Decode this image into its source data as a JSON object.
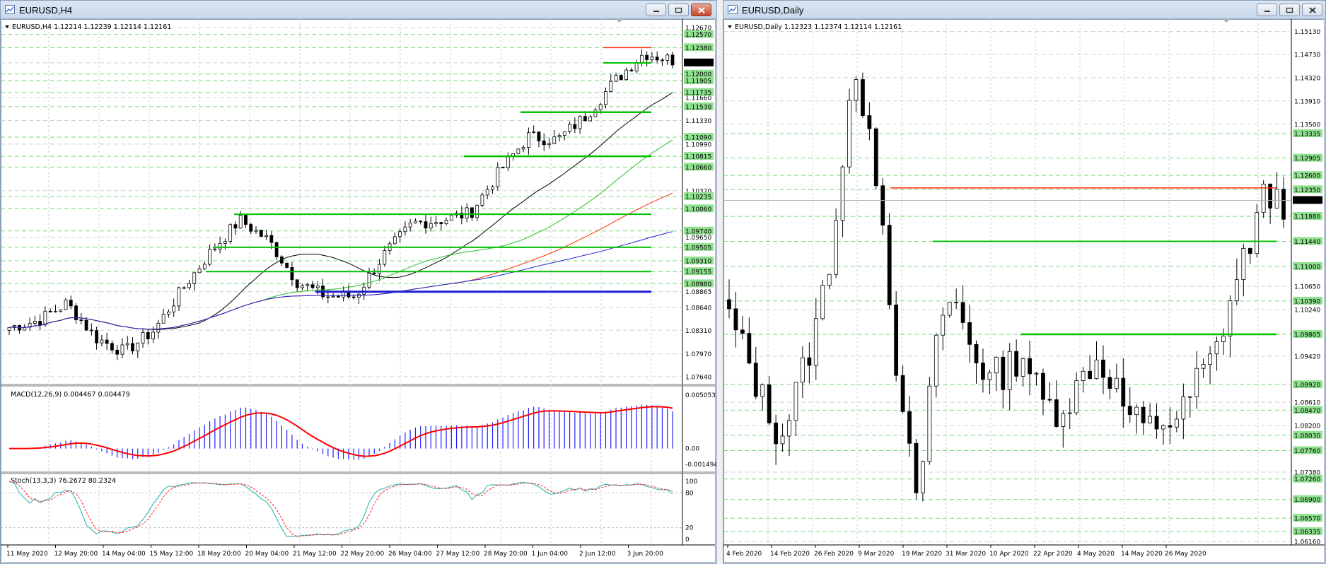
{
  "windows": {
    "left": {
      "title": "EURUSD,H4"
    },
    "right": {
      "title": "EURUSD,Daily"
    }
  },
  "h4": {
    "header": "EURUSD,H4  1.12214 1.12239 1.12114 1.12161",
    "price_labels": [
      "1.12670",
      "1.12570",
      "1.12380",
      "1.12161",
      "1.12000",
      "1.11905",
      "1.11660",
      "1.11735",
      "1.11530",
      "1.11330",
      "1.11090",
      "1.10990",
      "1.10815",
      "1.10660",
      "1.10320",
      "1.10235",
      "1.10060",
      "1.09740",
      "1.09650",
      "1.09505",
      "1.09310",
      "1.09155",
      "1.08980",
      "1.08865",
      "1.08640",
      "1.08310",
      "1.07970",
      "1.07640"
    ],
    "macd_header": "MACD(12,26,9) 0.004467 0.004479",
    "macd_labels": [
      "0.005053",
      "0.00",
      "-0.001494"
    ],
    "stoch_header": "Stoch(13,3,3) 76.2672 80.2324",
    "stoch_labels": [
      "100",
      "80",
      "20",
      "0"
    ],
    "time_labels": [
      "11 May 2020",
      "12 May 20:00",
      "14 May 04:00",
      "15 May 12:00",
      "18 May 20:00",
      "20 May 04:00",
      "21 May 12:00",
      "22 May 20:00",
      "26 May 04:00",
      "27 May 12:00",
      "28 May 20:00",
      "1 Jun 04:00",
      "2 Jun 12:00",
      "3 Jun 20:00"
    ]
  },
  "daily": {
    "header": "EURUSD,Daily  1.12323 1.12374 1.12114 1.12161",
    "price_labels": [
      "1.15130",
      "1.14730",
      "1.14320",
      "1.13910",
      "1.13500",
      "1.13335",
      "1.12905",
      "1.12600",
      "1.12350",
      "1.12161",
      "1.11880",
      "1.11440",
      "1.11000",
      "1.10650",
      "1.10390",
      "1.10240",
      "1.09805",
      "1.09420",
      "1.08920",
      "1.08610",
      "1.08470",
      "1.08200",
      "1.08030",
      "1.07760",
      "1.07380",
      "1.07260",
      "1.06900",
      "1.06570",
      "1.06335",
      "1.06160"
    ],
    "time_labels": [
      "4 Feb 2020",
      "14 Feb 2020",
      "26 Feb 2020",
      "9 Mar 2020",
      "19 Mar 2020",
      "31 Mar 2020",
      "10 Apr 2020",
      "22 Apr 2020",
      "4 May 2020",
      "14 May 2020",
      "26 May 2020"
    ]
  },
  "colors": {
    "bull_candle": "#ffffff",
    "bear_candle": "#000000",
    "support_line": "#00c000",
    "resistance_line": "#ff2a00",
    "ma_black": "#000000",
    "ma_green": "#22c022",
    "ma_red": "#ff3300",
    "ma_blue": "#1f1fd0",
    "level_dashed": "#7fd67f",
    "macd_hist": "#2020ff",
    "macd_signal": "#ff0000",
    "stoch_main": "#20b0b0",
    "stoch_signal": "#ff2020",
    "price_tag": "#000000",
    "level_tag": "#8fe08f"
  }
}
